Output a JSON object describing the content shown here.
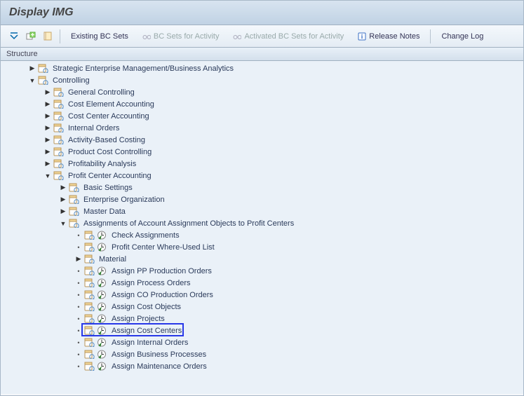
{
  "title": "Display IMG",
  "toolbar": {
    "existing_bc_sets": "Existing BC Sets",
    "bc_sets_activity": "BC Sets for Activity",
    "activated_bc_sets": "Activated BC Sets for Activity",
    "release_notes": "Release Notes",
    "change_log": "Change Log"
  },
  "structure_header": "Structure",
  "tree": [
    {
      "indent": 1,
      "expander": "closed",
      "doc": true,
      "exec": false,
      "label": "Strategic Enterprise Management/Business Analytics"
    },
    {
      "indent": 1,
      "expander": "open",
      "doc": true,
      "exec": false,
      "label": "Controlling"
    },
    {
      "indent": 2,
      "expander": "closed",
      "doc": true,
      "exec": false,
      "label": "General Controlling"
    },
    {
      "indent": 2,
      "expander": "closed",
      "doc": true,
      "exec": false,
      "label": "Cost Element Accounting"
    },
    {
      "indent": 2,
      "expander": "closed",
      "doc": true,
      "exec": false,
      "label": "Cost Center Accounting"
    },
    {
      "indent": 2,
      "expander": "closed",
      "doc": true,
      "exec": false,
      "label": "Internal Orders"
    },
    {
      "indent": 2,
      "expander": "closed",
      "doc": true,
      "exec": false,
      "label": "Activity-Based Costing"
    },
    {
      "indent": 2,
      "expander": "closed",
      "doc": true,
      "exec": false,
      "label": "Product Cost Controlling"
    },
    {
      "indent": 2,
      "expander": "closed",
      "doc": true,
      "exec": false,
      "label": "Profitability Analysis"
    },
    {
      "indent": 2,
      "expander": "open",
      "doc": true,
      "exec": false,
      "label": "Profit Center Accounting"
    },
    {
      "indent": 3,
      "expander": "closed",
      "doc": true,
      "exec": false,
      "label": "Basic Settings"
    },
    {
      "indent": 3,
      "expander": "closed",
      "doc": true,
      "exec": false,
      "label": "Enterprise Organization"
    },
    {
      "indent": 3,
      "expander": "closed",
      "doc": true,
      "exec": false,
      "label": "Master Data"
    },
    {
      "indent": 3,
      "expander": "open",
      "doc": true,
      "exec": false,
      "label": "Assignments of Account Assignment Objects to Profit Centers"
    },
    {
      "indent": 4,
      "expander": "bullet",
      "doc": true,
      "exec": true,
      "label": "Check Assignments"
    },
    {
      "indent": 4,
      "expander": "bullet",
      "doc": true,
      "exec": true,
      "label": "Profit Center Where-Used List"
    },
    {
      "indent": 4,
      "expander": "closed",
      "doc": true,
      "exec": false,
      "label": "Material"
    },
    {
      "indent": 4,
      "expander": "bullet",
      "doc": true,
      "exec": true,
      "label": "Assign PP Production Orders"
    },
    {
      "indent": 4,
      "expander": "bullet",
      "doc": true,
      "exec": true,
      "label": "Assign Process Orders"
    },
    {
      "indent": 4,
      "expander": "bullet",
      "doc": true,
      "exec": true,
      "label": "Assign CO Production Orders"
    },
    {
      "indent": 4,
      "expander": "bullet",
      "doc": true,
      "exec": true,
      "label": "Assign Cost Objects"
    },
    {
      "indent": 4,
      "expander": "bullet",
      "doc": true,
      "exec": true,
      "label": "Assign Projects"
    },
    {
      "indent": 4,
      "expander": "bullet",
      "doc": true,
      "exec": true,
      "label": "Assign Cost Centers",
      "highlight": true
    },
    {
      "indent": 4,
      "expander": "bullet",
      "doc": true,
      "exec": true,
      "label": "Assign Internal Orders"
    },
    {
      "indent": 4,
      "expander": "bullet",
      "doc": true,
      "exec": true,
      "label": "Assign Business Processes"
    },
    {
      "indent": 4,
      "expander": "bullet",
      "doc": true,
      "exec": true,
      "label": "Assign Maintenance Orders"
    }
  ]
}
